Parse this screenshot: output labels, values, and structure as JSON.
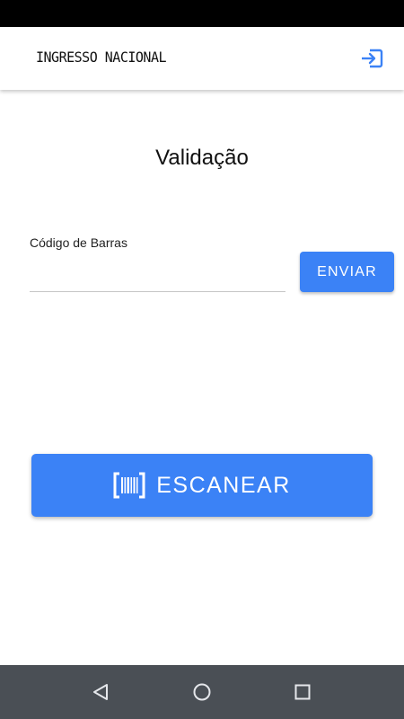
{
  "app": {
    "logo_text": "INGRESSO NACIONAL",
    "accent_color": "#3b82f6"
  },
  "header": {
    "logout_icon": "logout-icon"
  },
  "main": {
    "title": "Validação",
    "barcode_field": {
      "label": "Código de Barras",
      "value": "",
      "placeholder": ""
    },
    "send_button_label": "ENVIAR",
    "scan_button_label": "ESCANEAR",
    "scan_icon": "barcode-icon"
  },
  "system_nav": {
    "back_icon": "back-icon",
    "home_icon": "home-icon",
    "recents_icon": "recents-icon"
  }
}
